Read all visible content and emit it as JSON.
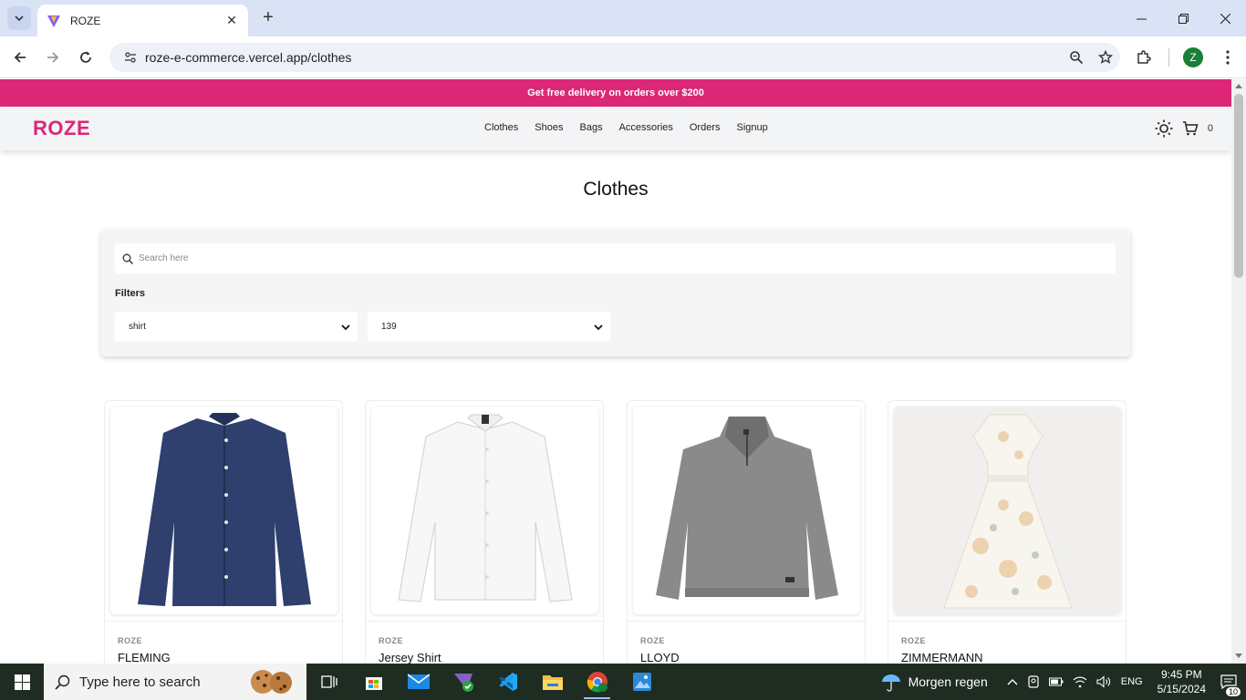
{
  "browser": {
    "tab_title": "ROZE",
    "tab_close": "✕",
    "new_tab": "+",
    "url": "roze-e-commerce.vercel.app/clothes",
    "profile_initial": "Z"
  },
  "site": {
    "promo_text": "Get free delivery on orders over $200",
    "logo": "ROZE",
    "nav": [
      "Clothes",
      "Shoes",
      "Bags",
      "Accessories",
      "Orders",
      "Signup"
    ],
    "cart_count": "0",
    "page_title": "Clothes",
    "search_placeholder": "Search here",
    "filters_label": "Filters",
    "filter_category_value": "shirt",
    "filter_price_value": "139",
    "products": [
      {
        "brand": "ROZE",
        "name": "FLEMING",
        "image": "navy-button-down-shirt"
      },
      {
        "brand": "ROZE",
        "name": "Jersey Shirt",
        "image": "white-dress-shirt"
      },
      {
        "brand": "ROZE",
        "name": "LLOYD",
        "image": "grey-quarter-zip-sweater"
      },
      {
        "brand": "ROZE",
        "name": "ZIMMERMANN",
        "image": "floral-white-dress"
      }
    ]
  },
  "taskbar": {
    "search_placeholder": "Type here to search",
    "weather": "Morgen regen",
    "language": "ENG",
    "time": "9:45 PM",
    "date": "5/15/2024",
    "notification_count": "10"
  },
  "colors": {
    "brand": "#db2777",
    "promo_bg": "#dc2777",
    "header_bg": "#f3f4f6",
    "chrome_tabbar": "#dae3f5",
    "taskbar_bg": "#1f2c22"
  }
}
